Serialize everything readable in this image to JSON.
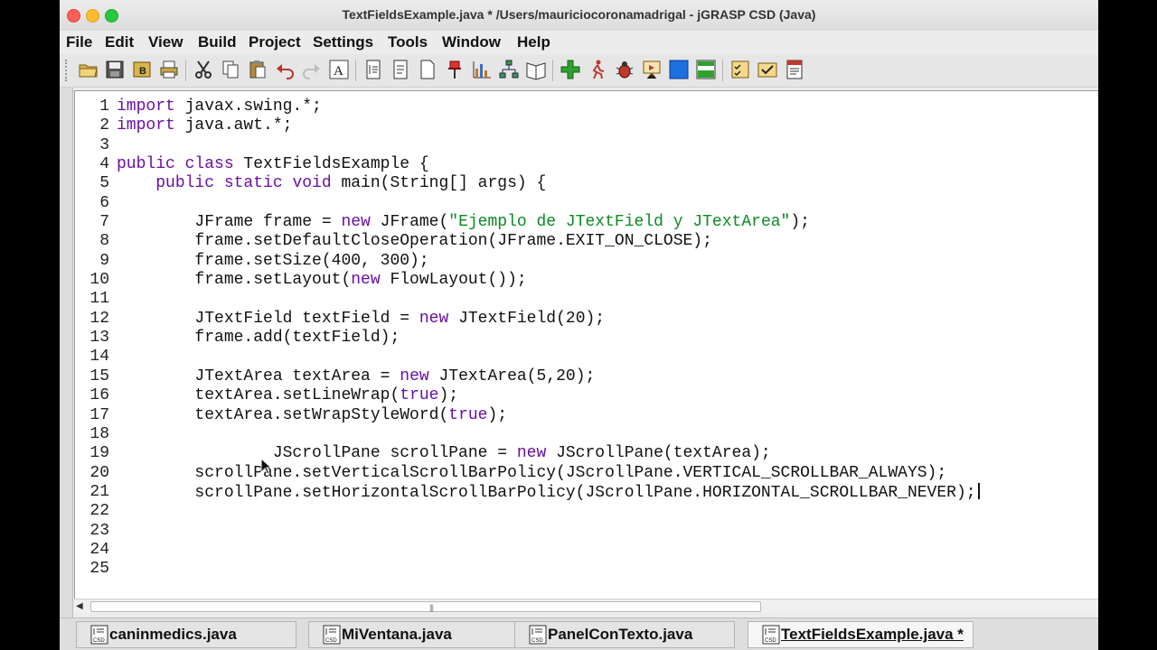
{
  "window": {
    "title": "TextFieldsExample.java *  /Users/mauriciocoronamadrigal - jGRASP CSD (Java)"
  },
  "menu": [
    "File",
    "Edit",
    "View",
    "Build",
    "Project",
    "Settings",
    "Tools",
    "Window",
    "Help"
  ],
  "toolbar_icons": [
    "open-folder-icon",
    "save-icon",
    "backup-icon",
    "print-icon",
    "cut-icon",
    "copy-icon",
    "paste-icon",
    "undo-icon",
    "redo-icon",
    "font-icon",
    "csd-icon",
    "remove-csd-icon",
    "page-icon",
    "pin-icon",
    "bar-chart-icon",
    "tree-icon",
    "book-icon",
    "compile-plus-icon",
    "run-figure-icon",
    "debug-bug-icon",
    "presentation-icon",
    "blue-square-icon",
    "green-window-icon",
    "checklist-icon",
    "envelope-check-icon",
    "report-icon"
  ],
  "editor": {
    "line_numbers": [
      "1",
      "2",
      "3",
      "4",
      "5",
      "6",
      "7",
      "8",
      "9",
      "10",
      "11",
      "12",
      "13",
      "14",
      "15",
      "16",
      "17",
      "18",
      "19",
      "20",
      "21",
      "22",
      "23",
      "24",
      "25"
    ],
    "lines": [
      [
        {
          "t": "import",
          "c": "kw"
        },
        {
          "t": " javax.swing.*;"
        }
      ],
      [
        {
          "t": "import",
          "c": "kw"
        },
        {
          "t": " java.awt.*;"
        }
      ],
      [],
      [
        {
          "t": "public class",
          "c": "kw"
        },
        {
          "t": " TextFieldsExample {"
        }
      ],
      [
        {
          "t": "    "
        },
        {
          "t": "public static void",
          "c": "kw"
        },
        {
          "t": " main(String[] args) {"
        }
      ],
      [],
      [
        {
          "t": "        JFrame frame = "
        },
        {
          "t": "new",
          "c": "kw"
        },
        {
          "t": " JFrame("
        },
        {
          "t": "\"Ejemplo de JTextField y JTextArea\"",
          "c": "str"
        },
        {
          "t": ");"
        }
      ],
      [
        {
          "t": "        frame.setDefaultCloseOperation(JFrame.EXIT_ON_CLOSE);"
        }
      ],
      [
        {
          "t": "        frame.setSize(400, 300);"
        }
      ],
      [
        {
          "t": "        frame.setLayout("
        },
        {
          "t": "new",
          "c": "kw"
        },
        {
          "t": " FlowLayout());"
        }
      ],
      [],
      [
        {
          "t": "        JTextField textField = "
        },
        {
          "t": "new",
          "c": "kw"
        },
        {
          "t": " JTextField(20);"
        }
      ],
      [
        {
          "t": "        frame.add(textField);"
        }
      ],
      [],
      [
        {
          "t": "        JTextArea textArea = "
        },
        {
          "t": "new",
          "c": "kw"
        },
        {
          "t": " JTextArea(5,20);"
        }
      ],
      [
        {
          "t": "        textArea.setLineWrap("
        },
        {
          "t": "true",
          "c": "kw"
        },
        {
          "t": ");"
        }
      ],
      [
        {
          "t": "        textArea.setWrapStyleWord("
        },
        {
          "t": "true",
          "c": "kw"
        },
        {
          "t": ");"
        }
      ],
      [],
      [
        {
          "t": "                JScrollPane scrollPane = "
        },
        {
          "t": "new",
          "c": "kw"
        },
        {
          "t": " JScrollPane(textArea);"
        }
      ],
      [
        {
          "t": "        scrollPane.setVerticalScrollBarPolicy(JScrollPane.VERTICAL_SCROLLBAR_ALWAYS);"
        }
      ],
      [
        {
          "t": "        scrollPane.setHorizontalScrollBarPolicy(JScrollPane.HORIZONTAL_SCROLLBAR_NEVER);"
        }
      ],
      [],
      [],
      [],
      []
    ],
    "caret_line": 21
  },
  "tabs": [
    {
      "label": "caninmedics.java",
      "active": false
    },
    {
      "label": "MiVentana.java",
      "active": false
    },
    {
      "label": "PanelConTexto.java",
      "active": false
    },
    {
      "label": "TextFieldsExample.java *",
      "active": true
    }
  ],
  "colors": {
    "keyword": "#6a0fa6",
    "string": "#0a8a20"
  }
}
